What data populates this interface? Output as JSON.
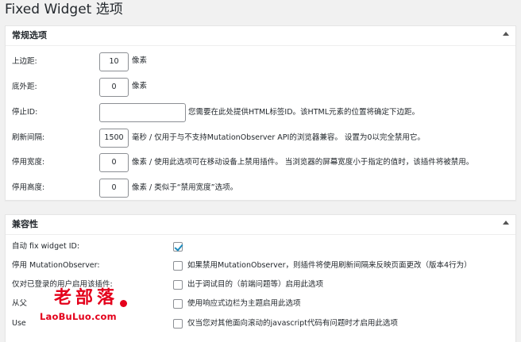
{
  "page": {
    "title": "Fixed Widget 选项"
  },
  "general": {
    "title": "常规选项",
    "rows": [
      {
        "label": "上边距:",
        "value": "10",
        "desc": "像素"
      },
      {
        "label": "底外距:",
        "value": "0",
        "desc": "像素"
      },
      {
        "label": "停止ID:",
        "value": "",
        "desc": "您需要在此处提供HTML标签ID。该HTML元素的位置将确定下边距。"
      },
      {
        "label": "刷新间隔:",
        "value": "1500",
        "desc": "毫秒 / 仅用于与不支持MutationObserver API的浏览器兼容。 设置为0以完全禁用它。"
      },
      {
        "label": "停用宽度:",
        "value": "0",
        "desc": "像素 / 使用此选项可在移动设备上禁用插件。 当浏览器的屏幕宽度小于指定的值时，该插件将被禁用。"
      },
      {
        "label": "停用高度:",
        "value": "0",
        "desc": "像素 / 类似于“禁用宽度”选项。"
      }
    ]
  },
  "compat": {
    "title": "兼容性",
    "rows": [
      {
        "label": "自动 fix widget ID:",
        "checked": true,
        "desc": ""
      },
      {
        "label": "停用 MutationObserver:",
        "checked": false,
        "desc": "如果禁用MutationObserver，则插件将使用刷新间隔来反映页面更改（版本4行为）"
      },
      {
        "label": "仅对已登录的用户启用该插件:",
        "checked": false,
        "desc": "出于调试目的（前端问题等）启用此选项"
      },
      {
        "label": "从父",
        "checked": false,
        "desc": "使用响应式边栏为主题启用此选项"
      },
      {
        "label": "Use",
        "checked": false,
        "desc": "仅当您对其他面向滚动的javascript代码有问题时才启用此选项"
      }
    ]
  },
  "watermark": {
    "text": "老部落",
    "url": "LaoBuLuo.com"
  },
  "colors": {
    "accent": "#1e8cbe",
    "watermark": "#e4001b"
  },
  "icons": {
    "collapse": "triangle-up-icon",
    "check": "checkmark-icon"
  }
}
